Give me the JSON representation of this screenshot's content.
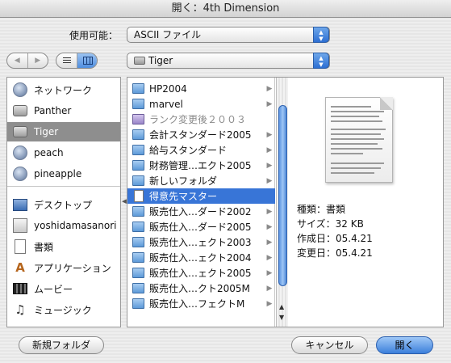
{
  "window": {
    "title": "開く：4th Dimension"
  },
  "format": {
    "label": "使用可能：",
    "value": "ASCII ファイル"
  },
  "nav": {
    "back_glyph": "◀",
    "forward_glyph": "▶"
  },
  "location": {
    "value": "Tiger"
  },
  "sidebar": {
    "items": [
      {
        "label": "ネットワーク",
        "icon": "globe-icon"
      },
      {
        "label": "Panther",
        "icon": "disk-icon"
      },
      {
        "label": "Tiger",
        "icon": "disk-icon",
        "selected": true
      },
      {
        "label": "peach",
        "icon": "globe-icon"
      },
      {
        "label": "pineapple",
        "icon": "globe-icon"
      },
      {
        "label": "デスクトップ",
        "icon": "desktop-icon"
      },
      {
        "label": "yoshidamasanori",
        "icon": "home-icon"
      },
      {
        "label": "書類",
        "icon": "documents-icon"
      },
      {
        "label": "アプリケーション",
        "icon": "applications-icon"
      },
      {
        "label": "ムービー",
        "icon": "movies-icon"
      },
      {
        "label": "ミュージック",
        "icon": "music-icon"
      }
    ]
  },
  "files": [
    {
      "name": "HP2004",
      "kind": "folder",
      "chevron": true
    },
    {
      "name": "marvel",
      "kind": "folder",
      "chevron": true
    },
    {
      "name": "ランク変更後２００３",
      "kind": "alias",
      "chevron": false,
      "dim": true
    },
    {
      "name": "会計スタンダード2005",
      "kind": "folder",
      "chevron": true
    },
    {
      "name": "給与スタンダード",
      "kind": "folder",
      "chevron": true
    },
    {
      "name": "財務管理…エクト2005",
      "kind": "folder",
      "chevron": true
    },
    {
      "name": "新しいフォルダ",
      "kind": "folder",
      "chevron": true
    },
    {
      "name": "得意先マスター",
      "kind": "document",
      "chevron": false,
      "selected": true
    },
    {
      "name": "販売仕入…ダード2002",
      "kind": "folder",
      "chevron": true
    },
    {
      "name": "販売仕入…ダード2005",
      "kind": "folder",
      "chevron": true
    },
    {
      "name": "販売仕入…ェクト2003",
      "kind": "folder",
      "chevron": true
    },
    {
      "name": "販売仕入…ェクト2004",
      "kind": "folder",
      "chevron": true
    },
    {
      "name": "販売仕入…ェクト2005",
      "kind": "folder",
      "chevron": true
    },
    {
      "name": "販売仕入…クト2005M",
      "kind": "folder",
      "chevron": true
    },
    {
      "name": "販売仕入…フェクトM",
      "kind": "folder",
      "chevron": true
    }
  ],
  "preview": {
    "kind": "種類：書類",
    "size": "サイズ：32 KB",
    "created": "作成日：05.4.21",
    "modified": "変更日：05.4.21"
  },
  "buttons": {
    "new_folder": "新規フォルダ",
    "cancel": "キャンセル",
    "open": "開く"
  },
  "colors": {
    "selection": "#3875d7",
    "sidebar_selection": "#8e8e8e",
    "default_button": "#3c7fdb"
  }
}
